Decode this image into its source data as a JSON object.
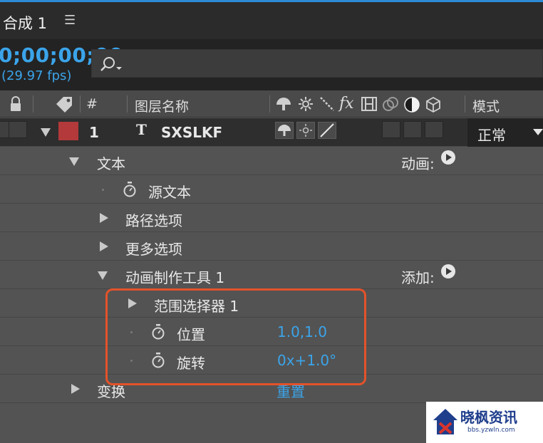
{
  "composition": {
    "title": "合成 1",
    "menu_glyph": "☰"
  },
  "timeline": {
    "timecode": "0;00;00;00",
    "fps": "(29.97 fps)"
  },
  "header": {
    "number_col": "#",
    "layer_name_col": "图层名称",
    "fx_glyph": "fx",
    "mode_col": "模式"
  },
  "layer": {
    "number": "1",
    "type_glyph": "T",
    "name": "SXSLKF",
    "mode": "正常",
    "label_color": "#b3393b"
  },
  "properties": {
    "text": {
      "label": "文本",
      "animate_label": "动画:"
    },
    "source_text": {
      "label": "源文本"
    },
    "path_options": {
      "label": "路径选项"
    },
    "more_options": {
      "label": "更多选项"
    },
    "animator": {
      "label": "动画制作工具 1",
      "add_label": "添加:"
    },
    "range_selector": {
      "label": "范围选择器 1"
    },
    "position": {
      "label": "位置",
      "value": "1.0,1.0"
    },
    "rotation": {
      "label": "旋转",
      "value": "0x+1.0°"
    },
    "transform": {
      "label": "变换",
      "reset_label": "重置"
    }
  },
  "watermark": {
    "title": "晓枫资讯",
    "subtitle": "bbs.yzwln.com"
  },
  "colors": {
    "accent": "#3ba4ea",
    "highlight_box": "#e4522a",
    "panel": "#535353"
  }
}
